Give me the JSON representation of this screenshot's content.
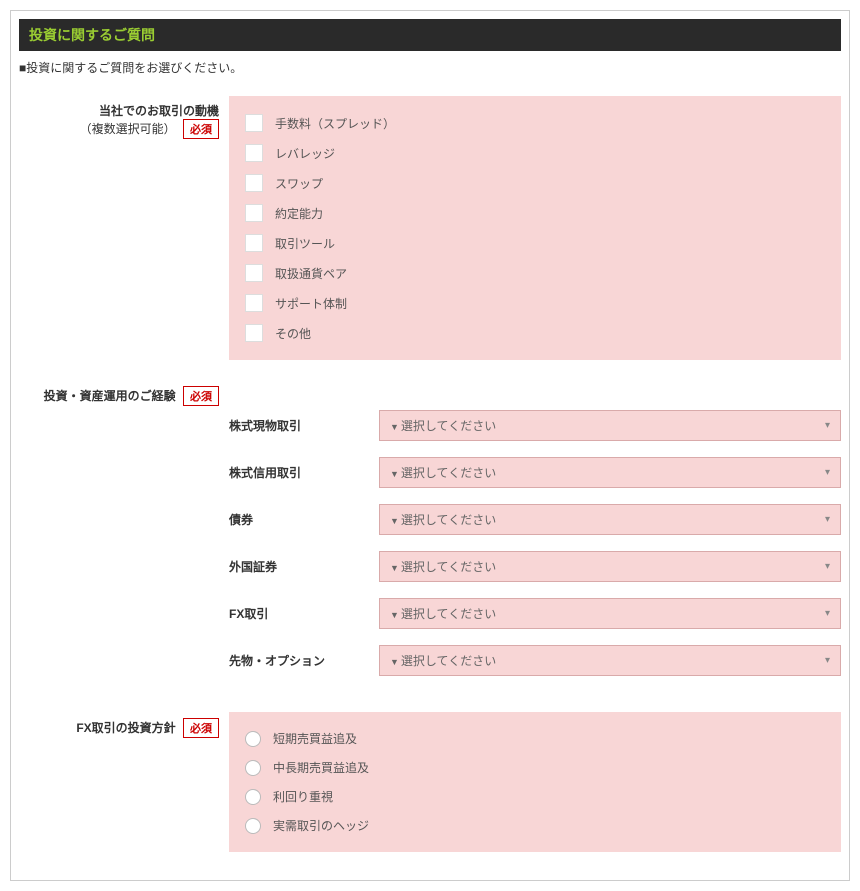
{
  "section": {
    "title": "投資に関するご質問",
    "subtext": "■投資に関するご質問をお選びください。"
  },
  "required_label": "必須",
  "motivation": {
    "label_line1": "当社でのお取引の動機",
    "label_line2": "（複数選択可能）",
    "options": [
      "手数料（スプレッド）",
      "レバレッジ",
      "スワップ",
      "約定能力",
      "取引ツール",
      "取扱通貨ペア",
      "サポート体制",
      "その他"
    ]
  },
  "experience": {
    "label": "投資・資産運用のご経験",
    "select_placeholder": "選択してください",
    "fields": [
      {
        "label": "株式現物取引"
      },
      {
        "label": "株式信用取引"
      },
      {
        "label": "債券"
      },
      {
        "label": "外国証券"
      },
      {
        "label": "FX取引"
      },
      {
        "label": "先物・オプション"
      }
    ]
  },
  "policy": {
    "label": "FX取引の投資方針",
    "options": [
      "短期売買益追及",
      "中長期売買益追及",
      "利回り重視",
      "実需取引のヘッジ"
    ]
  }
}
